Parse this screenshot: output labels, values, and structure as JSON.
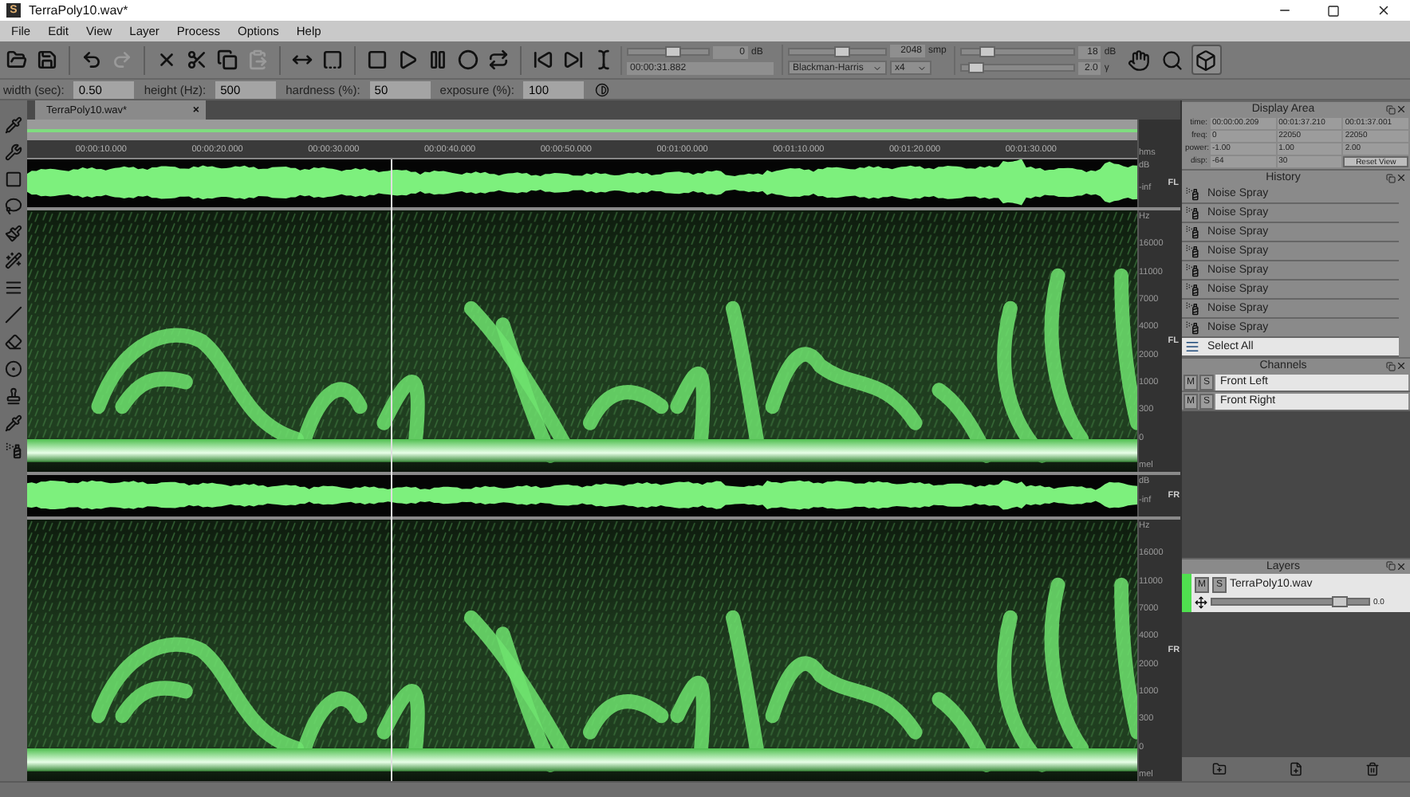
{
  "window": {
    "title": "TerraPoly10.wav*",
    "app_letter": "S"
  },
  "menu": [
    "File",
    "Edit",
    "View",
    "Layer",
    "Process",
    "Options",
    "Help"
  ],
  "transport": {
    "level": 0.55,
    "gain": "0",
    "gain_unit": "dB",
    "time": "00:00:31.882"
  },
  "fft": {
    "level": 0.55,
    "size": "2048",
    "size_unit": "smp",
    "window": "Blackman-Harris",
    "overlap": "x4"
  },
  "display": {
    "range": {
      "level": 0.22,
      "value": "18",
      "unit": "dB"
    },
    "gamma": {
      "level": 0.12,
      "value": "2.0",
      "unit": "γ"
    }
  },
  "view_tools": [
    {
      "selected": false
    },
    {
      "selected": false
    },
    {
      "selected": true
    }
  ],
  "brush_options": [
    {
      "label": "width (sec):",
      "value": "0.50"
    },
    {
      "label": "height (Hz):",
      "value": "500"
    },
    {
      "label": "hardness (%):",
      "value": "50"
    },
    {
      "label": "exposure (%):",
      "value": "100"
    }
  ],
  "document_tab": {
    "label": "TerraPoly10.wav*",
    "close": "×"
  },
  "ruler": {
    "ticks": [
      "00:00:10.000",
      "00:00:20.000",
      "00:00:30.000",
      "00:00:40.000",
      "00:00:50.000",
      "00:01:00.000",
      "00:01:10.000",
      "00:01:20.000",
      "00:01:30.000"
    ],
    "unit": "hms"
  },
  "tracks": [
    {
      "label": "FL",
      "wave_label": "FL",
      "wave_unit": "dB",
      "wave_floor": "-inf",
      "freq_unit": "Hz",
      "scale": "mel",
      "freq_ticks": [
        "16000",
        "11000",
        "7000",
        "4000",
        "2000",
        "1000",
        "300",
        "0"
      ]
    },
    {
      "label": "FR",
      "wave_label": "FR",
      "wave_unit": "dB",
      "wave_floor": "-inf",
      "freq_unit": "Hz",
      "scale": "mel",
      "freq_ticks": [
        "16000",
        "11000",
        "7000",
        "4000",
        "2000",
        "1000",
        "300",
        "0"
      ]
    }
  ],
  "display_area": {
    "title": "Display Area",
    "rows": [
      {
        "label": "time:",
        "values": [
          "00:00:00.209",
          "00:01:37.210",
          "00:01:37.001"
        ]
      },
      {
        "label": "freq:",
        "values": [
          "0",
          "22050",
          "22050"
        ]
      },
      {
        "label": "power:",
        "values": [
          "-1.00",
          "1.00",
          "2.00"
        ]
      },
      {
        "label": "disp:",
        "values": [
          "-64",
          "30"
        ]
      }
    ],
    "reset": "Reset View"
  },
  "history": {
    "title": "History",
    "items": [
      {
        "label": "Noise Spray",
        "kind": "spray",
        "selected": false
      },
      {
        "label": "Noise Spray",
        "kind": "spray",
        "selected": false
      },
      {
        "label": "Noise Spray",
        "kind": "spray",
        "selected": false
      },
      {
        "label": "Noise Spray",
        "kind": "spray",
        "selected": false
      },
      {
        "label": "Noise Spray",
        "kind": "spray",
        "selected": false
      },
      {
        "label": "Noise Spray",
        "kind": "spray",
        "selected": false
      },
      {
        "label": "Noise Spray",
        "kind": "spray",
        "selected": false
      },
      {
        "label": "Noise Spray",
        "kind": "spray",
        "selected": false
      },
      {
        "label": "Select All",
        "kind": "select",
        "selected": true
      }
    ]
  },
  "channels": {
    "title": "Channels",
    "items": [
      {
        "mute": "M",
        "solo": "S",
        "name": "Front Left"
      },
      {
        "mute": "M",
        "solo": "S",
        "name": "Front Right"
      }
    ]
  },
  "layers": {
    "title": "Layers",
    "items": [
      {
        "mute": "M",
        "solo": "S",
        "name": "TerraPoly10.wav",
        "color": "#4fe04f",
        "level": 0.82,
        "value": "0.0"
      }
    ]
  }
}
